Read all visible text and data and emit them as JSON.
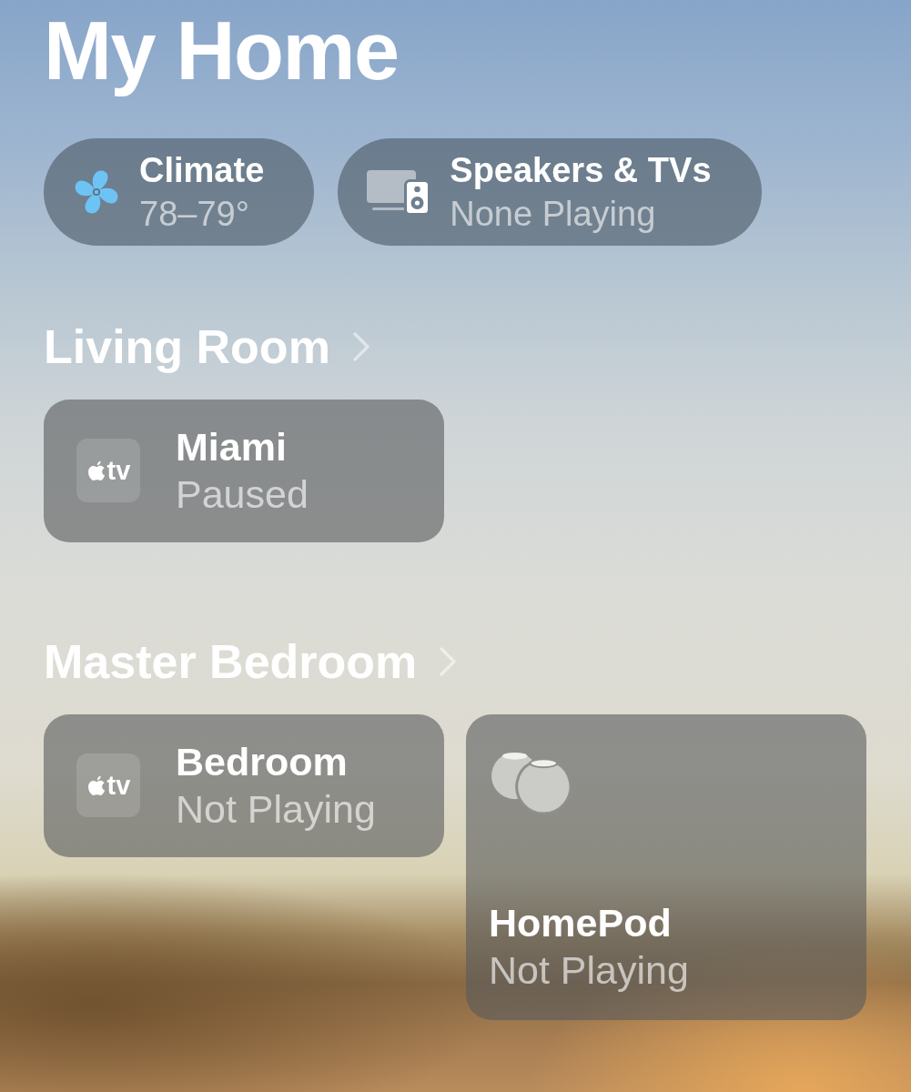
{
  "title": "My Home",
  "summary": [
    {
      "kind": "climate",
      "label": "Climate",
      "value": "78–79°"
    },
    {
      "kind": "media",
      "label": "Speakers & TVs",
      "value": "None Playing"
    }
  ],
  "rooms": [
    {
      "name": "Living Room",
      "accessories": [
        {
          "kind": "tv",
          "logo_text": "tv",
          "name": "Miami",
          "status": "Paused"
        }
      ]
    },
    {
      "name": "Master Bedroom",
      "accessories": [
        {
          "kind": "tv",
          "logo_text": "tv",
          "name": "Bedroom",
          "status": "Not Playing"
        },
        {
          "kind": "speaker",
          "name": "HomePod",
          "status": "Not Playing"
        }
      ]
    }
  ]
}
